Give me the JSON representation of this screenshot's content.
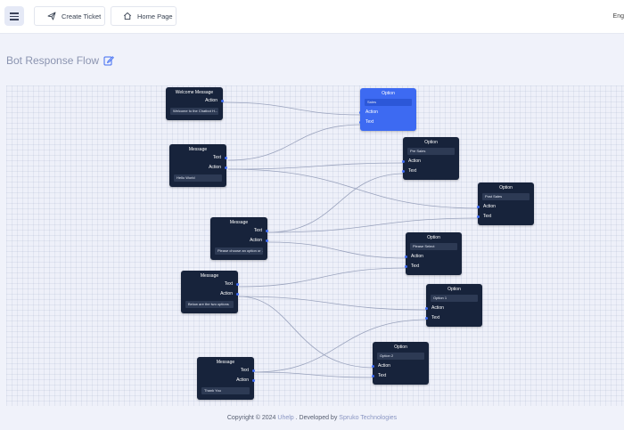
{
  "header": {
    "create_ticket": "Create Ticket",
    "home_page": "Home Page",
    "language": "Eng"
  },
  "page": {
    "title": "Bot Response Flow"
  },
  "nodes": {
    "welcome": {
      "title": "Welcome Message",
      "action": "Action",
      "value": "Welcome to the Chatbot H..."
    },
    "msg1": {
      "title": "Message",
      "text": "Text",
      "action": "Action",
      "value": "Hello World"
    },
    "msg2": {
      "title": "Message",
      "text": "Text",
      "action": "Action",
      "value": "Please choose an option or ..."
    },
    "msg3": {
      "title": "Message",
      "text": "Text",
      "action": "Action",
      "value": "Below are the two options"
    },
    "msg4": {
      "title": "Message",
      "text": "Text",
      "action": "Action",
      "value": "Thank You"
    },
    "opt_sales": {
      "title": "Option",
      "value": "Sales",
      "action": "Action",
      "text": "Text"
    },
    "opt_presales": {
      "title": "Option",
      "value": "Pre Sales",
      "action": "Action",
      "text": "Text"
    },
    "opt_postsales": {
      "title": "Option",
      "value": "Post Sales",
      "action": "Action",
      "text": "Text"
    },
    "opt_select": {
      "title": "Option",
      "value": "Please Select",
      "action": "Action",
      "text": "Text"
    },
    "opt_1": {
      "title": "Option",
      "value": "Option 1",
      "action": "Action",
      "text": "Text"
    },
    "opt_2": {
      "title": "Option",
      "value": "Option 2",
      "action": "Action",
      "text": "Text"
    }
  },
  "footer": {
    "prefix": "Copyright © 2024 ",
    "brand": "Uhelp",
    "middle": " . Developed by ",
    "company": "Spruko Technologies"
  },
  "colors": {
    "node_bg": "#17233b",
    "node_active": "#3d6af2",
    "edge": "#9aa3bd"
  }
}
